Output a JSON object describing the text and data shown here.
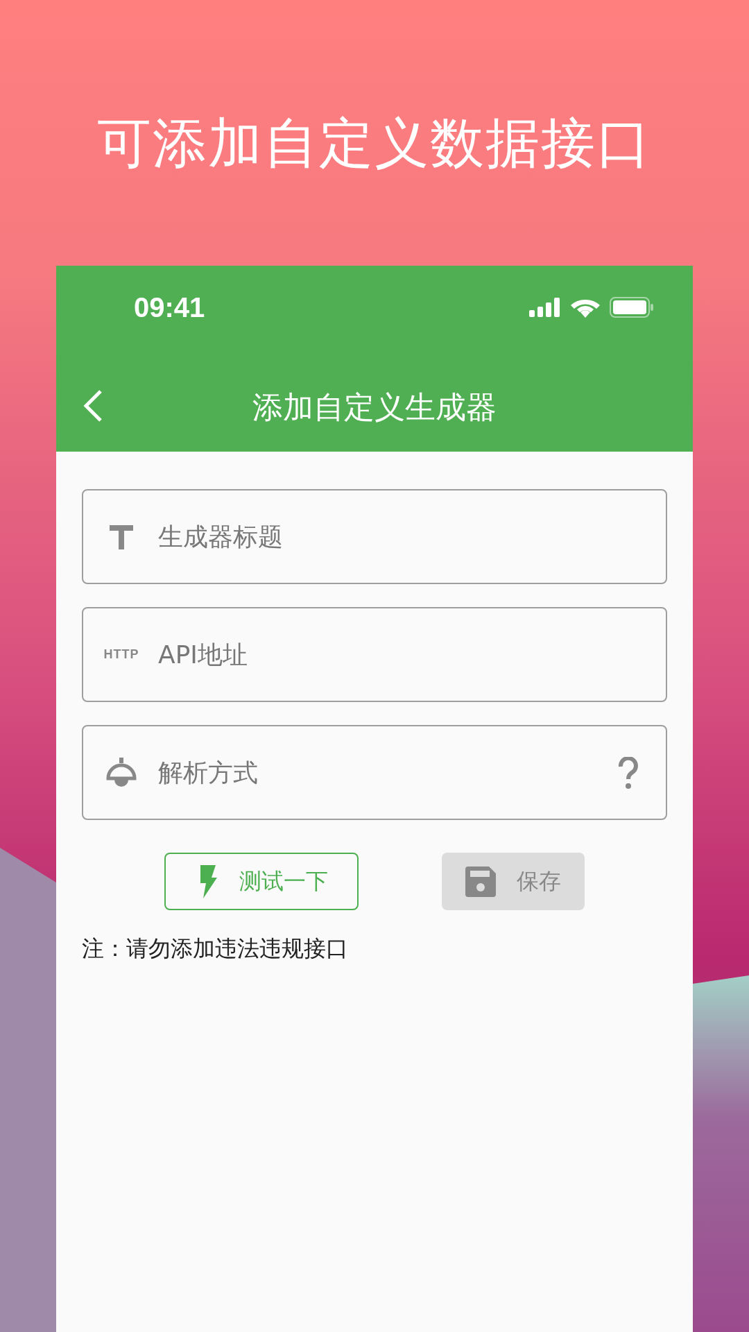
{
  "headline": "可添加自定义数据接口",
  "status_bar": {
    "time": "09:41"
  },
  "nav_bar": {
    "title": "添加自定义生成器"
  },
  "fields": [
    {
      "kind": "text",
      "placeholder": "生成器标题",
      "help": false
    },
    {
      "kind": "http",
      "icon_text": "HTTP",
      "placeholder": "API地址",
      "help": false
    },
    {
      "kind": "bell",
      "placeholder": "解析方式",
      "help": true
    }
  ],
  "buttons": [
    {
      "kind": "test",
      "label": "测试一下",
      "disabled": false
    },
    {
      "kind": "save",
      "label": "保存",
      "disabled": true
    }
  ],
  "note": "注：请勿添加违法违规接口"
}
